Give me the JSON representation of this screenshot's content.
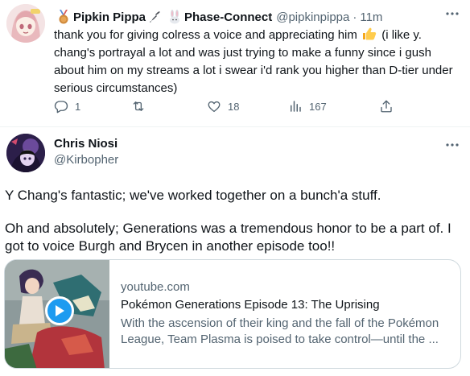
{
  "tweet1": {
    "display_name": "Pipkin Pippa",
    "affiliation": "Phase-Connect",
    "handle": "@pipkinpippa",
    "separator": "·",
    "time": "11m",
    "text_before_emoji": "thank you for giving colress a voice and appreciating him",
    "text_after_emoji": "(i like y. chang's portrayal a lot and was just trying to make a funny since i gush about him on my streams a lot i swear i'd rank you higher than D-tier under serious circumstances)",
    "reply_count": "1",
    "retweet_count": "",
    "like_count": "18",
    "view_count": "167"
  },
  "tweet2": {
    "display_name": "Chris Niosi",
    "handle": "@Kirbopher",
    "paragraph1": "Y Chang's fantastic; we've worked together on a bunch'a stuff.",
    "paragraph2": "Oh and absolutely; Generations was a tremendous honor to be a part of. I got to voice Burgh and Brycen in another episode too!!"
  },
  "card": {
    "domain": "youtube.com",
    "title": "Pokémon Generations Episode 13: The Uprising",
    "description": "With the ascension of their king and the fall of the Pokémon League, Team Plasma is poised to take control—until the ..."
  },
  "colors": {
    "accent": "#1d9bf0",
    "text_primary": "#0f1419",
    "text_secondary": "#536471",
    "border": "#cfd9de"
  },
  "icons": [
    "medal-icon",
    "plug-icon",
    "bunny-icon",
    "thumbs-up-icon",
    "reply-icon",
    "retweet-icon",
    "like-icon",
    "views-icon",
    "share-icon",
    "more-icon",
    "play-icon"
  ]
}
